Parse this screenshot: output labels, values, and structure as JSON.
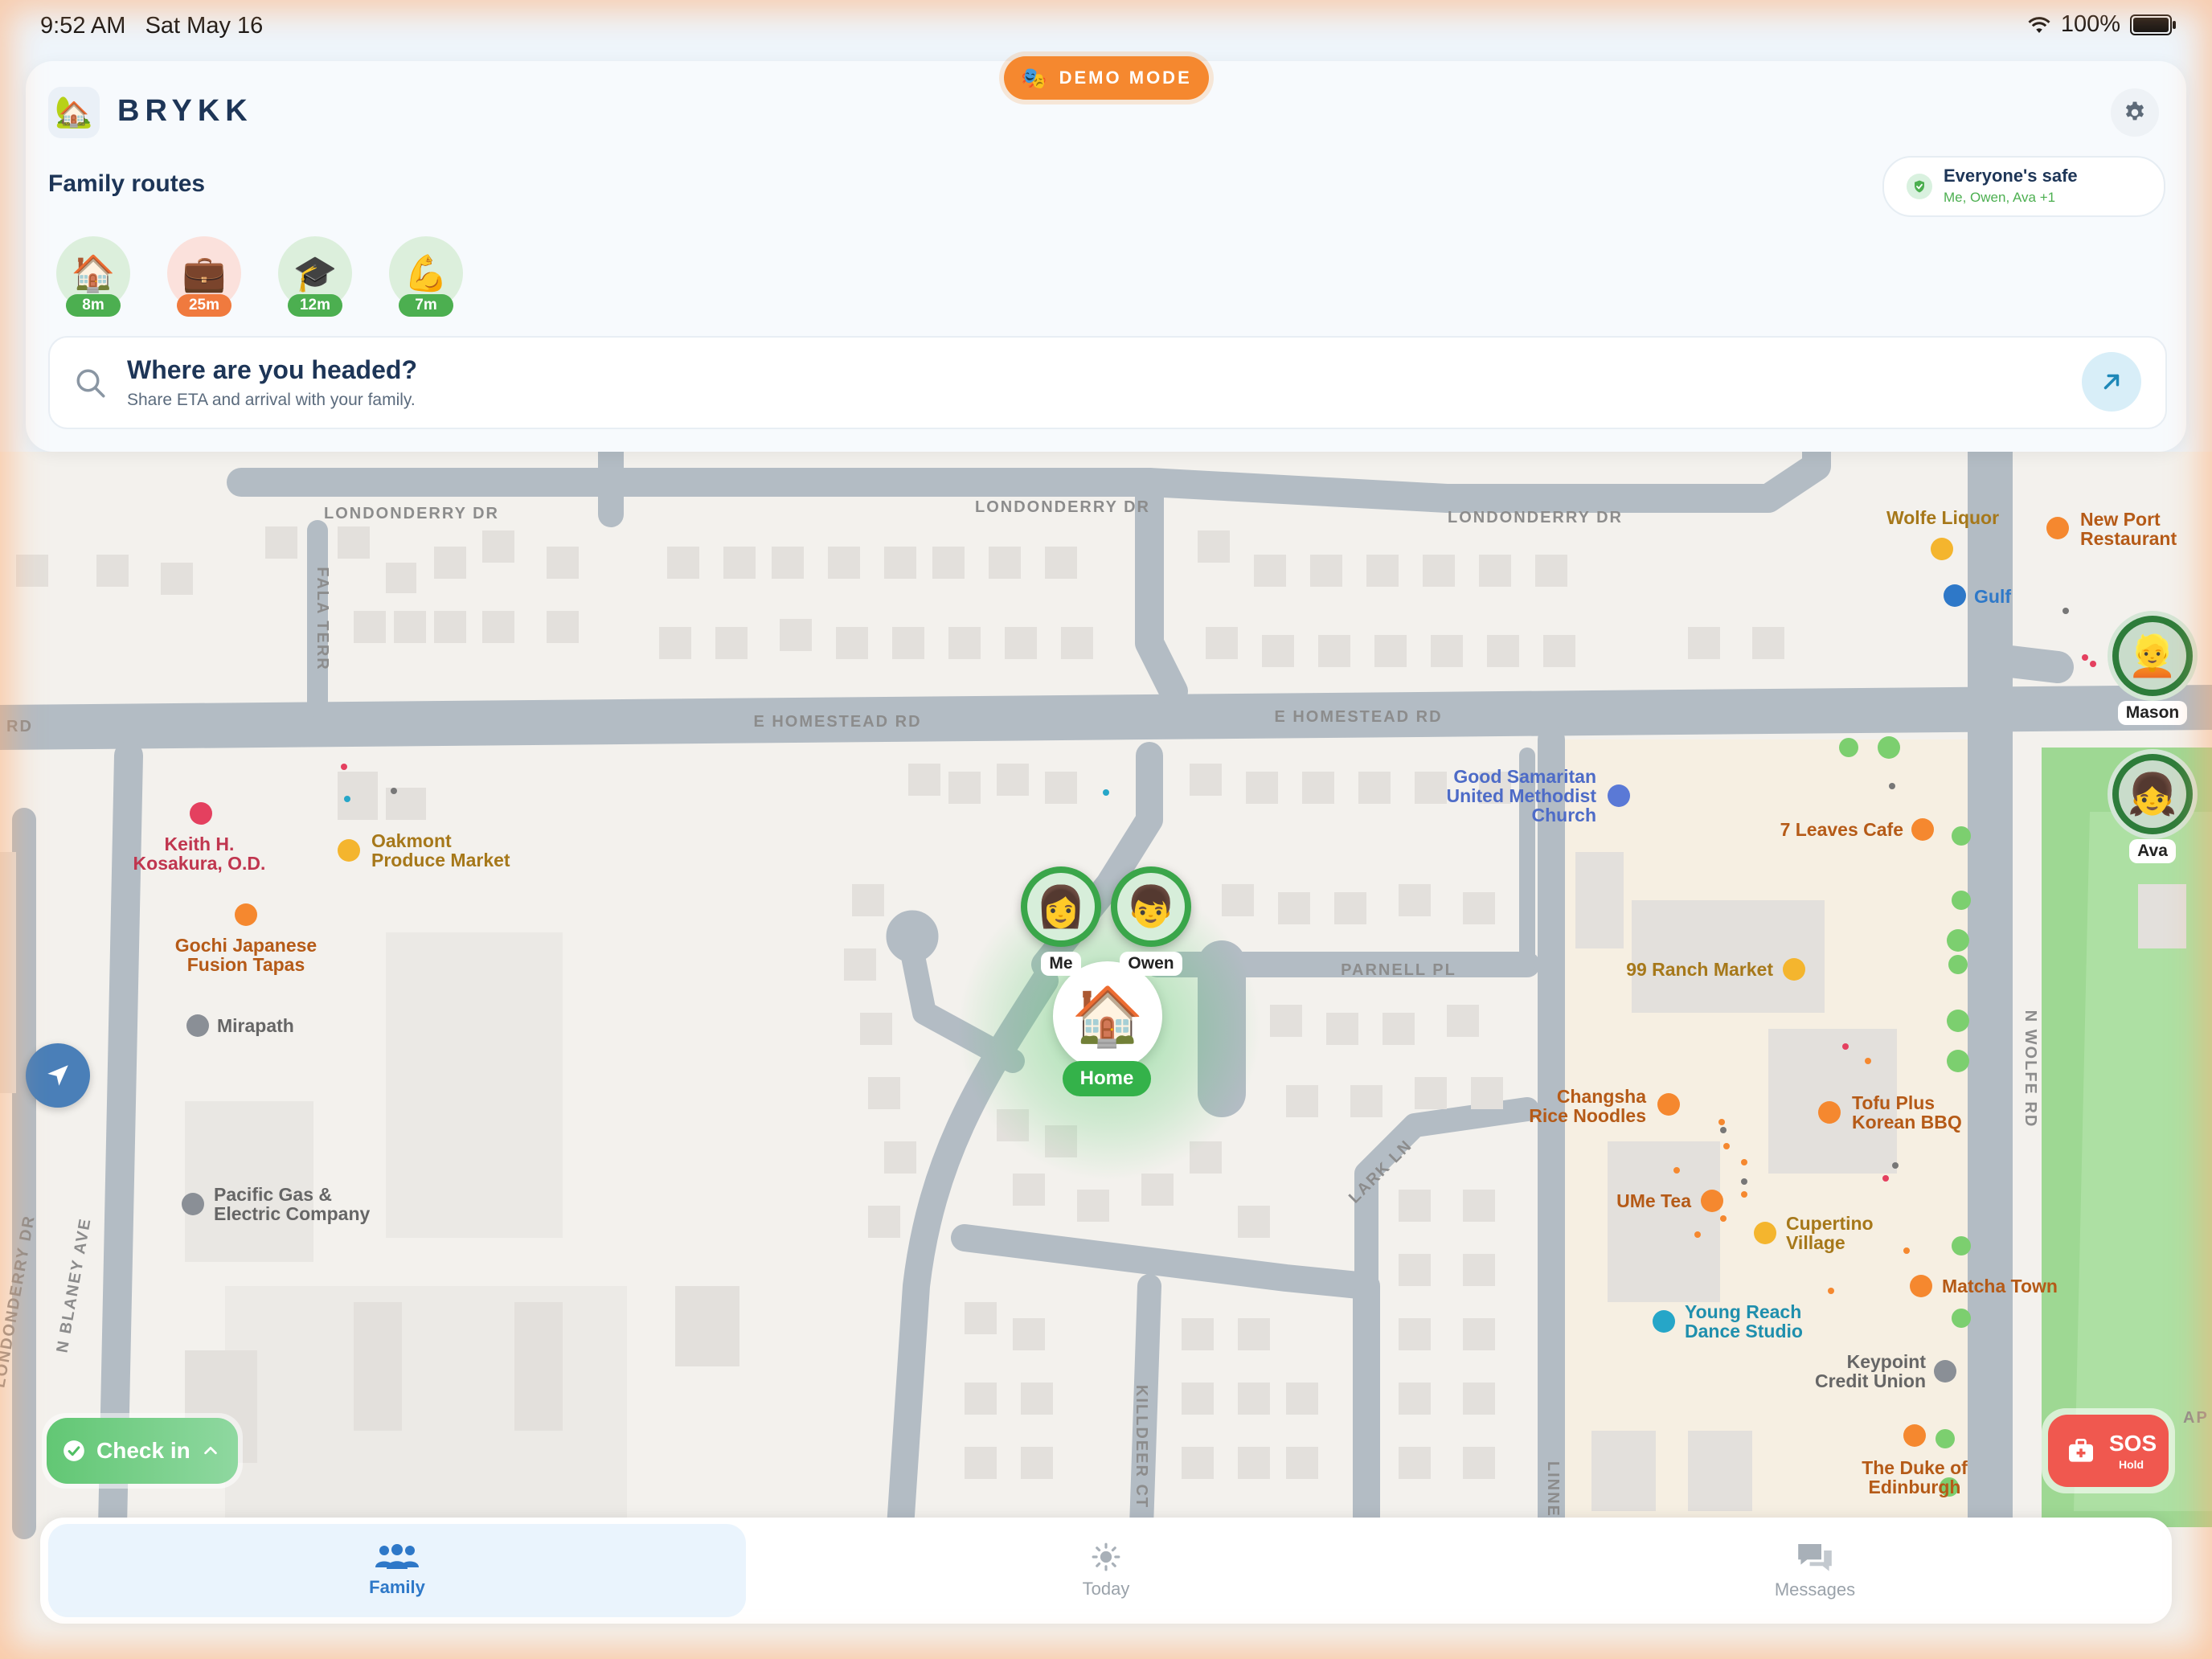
{
  "status_bar": {
    "time": "9:52 AM",
    "date": "Sat May 16",
    "battery": "100%"
  },
  "demo_mode": {
    "label": "DEMO MODE"
  },
  "app": {
    "name": "BRYKK"
  },
  "family_routes": {
    "title": "Family routes",
    "routes": [
      {
        "icon": "house",
        "eta": "8m"
      },
      {
        "icon": "briefcase",
        "eta": "25m"
      },
      {
        "icon": "graduation-cap",
        "eta": "12m"
      },
      {
        "icon": "flexed-biceps",
        "eta": "7m"
      }
    ]
  },
  "safety_status": {
    "title": "Everyone's safe",
    "members": "Me, Owen, Ava +1"
  },
  "search": {
    "title": "Where are you headed?",
    "subtitle": "Share ETA and arrival with your family."
  },
  "map": {
    "roads": {
      "londonderry_1": "LONDONDERRY DR",
      "londonderry_2": "LONDONDERRY DR",
      "londonderry_3": "LONDONDERRY DR",
      "homestead_1": "E HOMESTEAD RD",
      "homestead_2": "E HOMESTEAD RD",
      "homestead_rd_left": "RD",
      "fala_terr": "FALA TERR",
      "parnell_pl": "PARNELL PL",
      "lark_ln": "LARK LN",
      "killdeer_ct": "KILLDEER CT",
      "n_blaney_ave": "N BLANEY AVE",
      "n_wolfe_rd": "N WOLFE RD",
      "linnet": "LINNET",
      "londonderry_left": "LONDONDERRY DR",
      "ap": "AP"
    },
    "pois": {
      "wolfe_liquor": "Wolfe Liquor",
      "new_port_1": "New Port",
      "new_port_2": "Restaurant",
      "gulf": "Gulf",
      "good_sam_1": "Good Samaritan",
      "good_sam_2": "United Methodist",
      "good_sam_3": "Church",
      "seven_leaves": "7 Leaves Cafe",
      "keith_1": "Keith H.",
      "keith_2": "Kosakura, O.D.",
      "oakmont_1": "Oakmont",
      "oakmont_2": "Produce Market",
      "gochi_1": "Gochi Japanese",
      "gochi_2": "Fusion Tapas",
      "mirapath": "Mirapath",
      "pge_1": "Pacific Gas &",
      "pge_2": "Electric Company",
      "ranch99": "99 Ranch Market",
      "changsha_1": "Changsha",
      "changsha_2": "Rice Noodles",
      "tofu_1": "Tofu Plus",
      "tofu_2": "Korean BBQ",
      "ume": "UMe Tea",
      "cupertino_1": "Cupertino",
      "cupertino_2": "Village",
      "matcha": "Matcha Town",
      "young_1": "Young Reach",
      "young_2": "Dance Studio",
      "keypoint_1": "Keypoint",
      "keypoint_2": "Credit Union",
      "duke_1": "The Duke of",
      "duke_2": "Edinburgh"
    },
    "home_label": "Home",
    "members": [
      {
        "name": "Me",
        "avatar": "woman"
      },
      {
        "name": "Owen",
        "avatar": "boy"
      },
      {
        "name": "Mason",
        "avatar": "man"
      },
      {
        "name": "Ava",
        "avatar": "girl"
      }
    ]
  },
  "check_in": {
    "label": "Check in"
  },
  "sos": {
    "label": "SOS",
    "sublabel": "Hold"
  },
  "tabs": [
    {
      "label": "Family",
      "icon": "people-icon",
      "active": true
    },
    {
      "label": "Today",
      "icon": "sun-icon",
      "active": false
    },
    {
      "label": "Messages",
      "icon": "chat-bubbles-icon",
      "active": false
    }
  ],
  "colors": {
    "accent": "#2e78c8",
    "brand": "#1d3557",
    "safe": "#34b24a",
    "demo": "#f5882f",
    "sos": "#f0584f"
  }
}
